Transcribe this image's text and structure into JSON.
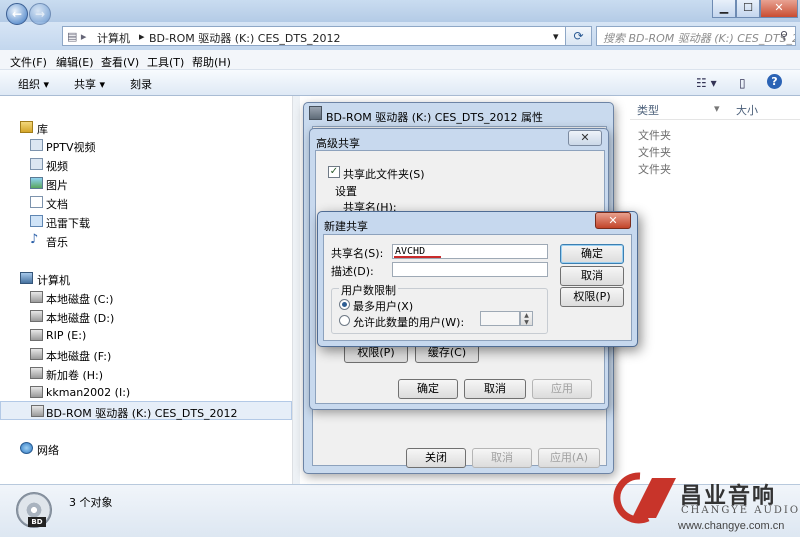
{
  "explorer": {
    "address": {
      "computer": "计算机",
      "drive": "BD-ROM 驱动器 (K:) CES_DTS_2012"
    },
    "search_placeholder": "搜索 BD-ROM 驱动器 (K:) CES_DTS_2012",
    "menu": [
      "文件(F)",
      "编辑(E)",
      "查看(V)",
      "工具(T)",
      "帮助(H)"
    ],
    "toolbar": {
      "organize": "组织 ▾",
      "share": "共享 ▾",
      "burn": "刻录"
    },
    "nav": {
      "library": "库",
      "library_items": [
        "PPTV视频",
        "视频",
        "图片",
        "文档",
        "迅雷下载",
        "音乐"
      ],
      "computer": "计算机",
      "drives": [
        "本地磁盘 (C:)",
        "本地磁盘 (D:)",
        "RIP (E:)",
        "本地磁盘 (F:)",
        "新加卷 (H:)",
        "kkman2002 (I:)",
        "BD-ROM 驱动器 (K:) CES_DTS_2012"
      ],
      "network": "网络"
    },
    "columns": {
      "type": "类型",
      "size": "大小"
    },
    "rows_type": [
      "文件夹",
      "文件夹",
      "文件夹"
    ],
    "status": "3 个对象",
    "dvd_label": "BD"
  },
  "properties": {
    "title": "BD-ROM 驱动器 (K:) CES_DTS_2012 属性",
    "close": "关闭",
    "cancel": "取消",
    "apply": "应用(A)"
  },
  "advanced": {
    "title": "高级共享",
    "share_checkbox": "共享此文件夹(S)",
    "settings_label": "设置",
    "share_name_label": "共享名(H):",
    "permissions": "权限(P)",
    "cache": "缓存(C)",
    "ok": "确定",
    "cancel": "取消",
    "apply": "应用"
  },
  "new_share": {
    "title": "新建共享",
    "share_name_label": "共享名(S):",
    "share_name_value": "AVCHD",
    "description_label": "描述(D):",
    "user_limit_label": "用户数限制",
    "max_users": "最多用户(X)",
    "allow_users": "允许此数量的用户(W):",
    "ok": "确定",
    "cancel": "取消",
    "permissions": "权限(P)"
  },
  "watermark": {
    "name": "昌业音响",
    "sub": "CHANGYE AUDIO",
    "url": "www.changye.com.cn"
  },
  "colors": {
    "accent": "#c92b2b",
    "brand": "#c8342a"
  },
  "icons": [
    "back-arrow-icon",
    "forward-arrow-icon",
    "refresh-icon",
    "search-icon",
    "library-icon",
    "computer-icon",
    "network-icon",
    "drive-icon",
    "dvd-icon"
  ]
}
